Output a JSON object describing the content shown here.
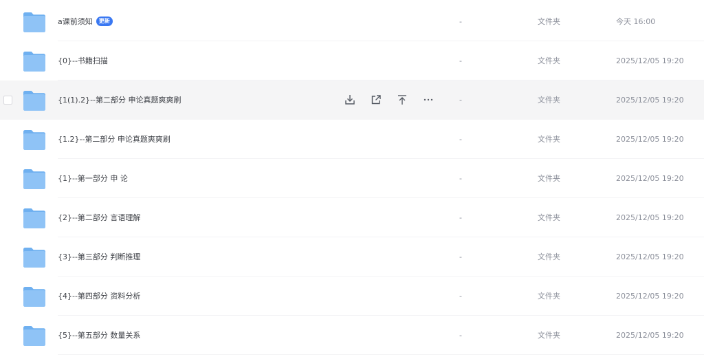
{
  "colors": {
    "accent": "#3a78f2",
    "folder": "#86bdf5",
    "hover_row": "#f5f5f6",
    "text_primary": "#3c3f45",
    "text_secondary": "#8a8e99"
  },
  "row_actions": [
    {
      "icon": "download-icon"
    },
    {
      "icon": "share-icon"
    },
    {
      "icon": "pin-to-top-icon"
    },
    {
      "icon": "more-icon"
    }
  ],
  "files": [
    {
      "name": "a课前须知",
      "badge": "更新",
      "size": "-",
      "type": "文件夹",
      "date": "今天 16:00",
      "hover": false
    },
    {
      "name": "{0}--书籍扫描",
      "badge": "",
      "size": "-",
      "type": "文件夹",
      "date": "2025/12/05 19:20",
      "hover": false
    },
    {
      "name": "{1(1).2}--第二部分 申论真题爽爽刷",
      "badge": "",
      "size": "-",
      "type": "文件夹",
      "date": "2025/12/05 19:20",
      "hover": true
    },
    {
      "name": "{1.2}--第二部分 申论真题爽爽刷",
      "badge": "",
      "size": "-",
      "type": "文件夹",
      "date": "2025/12/05 19:20",
      "hover": false
    },
    {
      "name": "{1}--第一部分 申 论",
      "badge": "",
      "size": "-",
      "type": "文件夹",
      "date": "2025/12/05 19:20",
      "hover": false
    },
    {
      "name": "{2}--第二部分 言语理解",
      "badge": "",
      "size": "-",
      "type": "文件夹",
      "date": "2025/12/05 19:20",
      "hover": false
    },
    {
      "name": "{3}--第三部分 判断推理",
      "badge": "",
      "size": "-",
      "type": "文件夹",
      "date": "2025/12/05 19:20",
      "hover": false
    },
    {
      "name": "{4}--第四部分 资料分析",
      "badge": "",
      "size": "-",
      "type": "文件夹",
      "date": "2025/12/05 19:20",
      "hover": false
    },
    {
      "name": "{5}--第五部分 数量关系",
      "badge": "",
      "size": "-",
      "type": "文件夹",
      "date": "2025/12/05 19:20",
      "hover": false
    }
  ]
}
